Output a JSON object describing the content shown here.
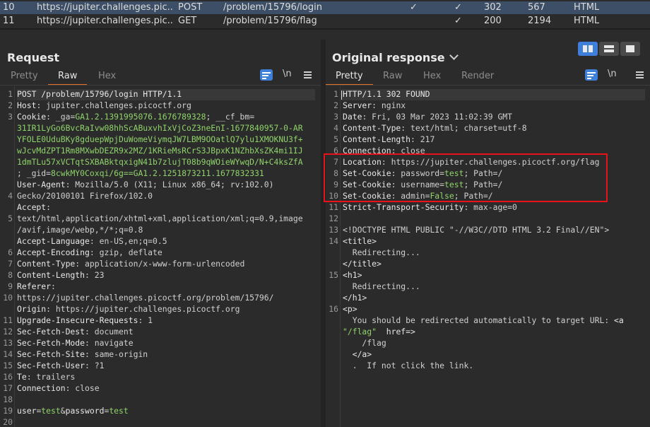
{
  "history": {
    "rows": [
      {
        "num": "10",
        "host": "https://jupiter.challenges.pic...",
        "method": "POST",
        "url": "/problem/15796/login",
        "edited": "✓",
        "params": "✓",
        "status": "302",
        "length": "567",
        "mime": "HTML"
      },
      {
        "num": "11",
        "host": "https://jupiter.challenges.pic...",
        "method": "GET",
        "url": "/problem/15796/flag",
        "edited": "",
        "params": "✓",
        "status": "200",
        "length": "2194",
        "mime": "HTML"
      }
    ]
  },
  "request": {
    "title": "Request",
    "tabs": [
      "Pretty",
      "Raw",
      "Hex"
    ],
    "active_tab": "Raw",
    "newline_label": "\\n",
    "line_numbers": [
      "1",
      "2",
      "3",
      "",
      "",
      "",
      "",
      "",
      "",
      "4",
      "",
      "5",
      "",
      "",
      "6",
      "7",
      "8",
      "9",
      "10",
      "",
      "11",
      "12",
      "13",
      "14",
      "15",
      "16",
      "17",
      "18",
      "19",
      "20"
    ],
    "lines": [
      {
        "k": "POST /problem/15796/login HTTP/1.1",
        "v": ""
      },
      {
        "k": "Host",
        "v": ": jupiter.challenges.picoctf.org"
      },
      {
        "k": "Cookie",
        "v": ": _ga=",
        "g": "GA1.2.1391995076.1676789328",
        "v2": "; __cf_bm="
      },
      {
        "g": "31IR1LyGo6BvcRaIvw08hhScABuxvhIxVjCoZ3neEnI-1677840957-0-AR"
      },
      {
        "g": "YFOLE0UduBKy8gduepWpjDuWomeViymqJW7LBM9OOatlQ7ylu1XMOKNU3f+"
      },
      {
        "g": "wJcvMdZPT1Rm8MXwbDEZR9x2MZ/1KRieMsRCrS3JBpxK1NZhbXsZK4mi1IJ"
      },
      {
        "g": "1dmTLu57xVCTqtSXBABktqxigN41b7zlujT08b9qWOieWYwqD/N+C4ksZfA"
      },
      {
        "g": "8cwkMY0Coxqi/6g==",
        "v": "; _gid=",
        "g2": "GA1.2.1251873211.1677832331"
      },
      {
        "k": "User-Agent",
        "v": ": Mozilla/5.0 (X11; Linux x86_64; rv:102.0)"
      },
      {
        "v": "Gecko/20100101 Firefox/102.0"
      },
      {
        "k": "Accept",
        "v": ":"
      },
      {
        "v": "text/html,application/xhtml+xml,application/xml;q=0.9,image"
      },
      {
        "v": "/avif,image/webp,*/*;q=0.8"
      },
      {
        "k": "Accept-Language",
        "v": ": en-US,en;q=0.5"
      },
      {
        "k": "Accept-Encoding",
        "v": ": gzip, deflate"
      },
      {
        "k": "Content-Type",
        "v": ": application/x-www-form-urlencoded"
      },
      {
        "k": "Content-Length",
        "v": ": 23"
      },
      {
        "k": "Referer",
        "v": ":"
      },
      {
        "v": "https://jupiter.challenges.picoctf.org/problem/15796/"
      },
      {
        "k": "Origin",
        "v": ": https://jupiter.challenges.picoctf.org"
      },
      {
        "k": "Upgrade-Insecure-Requests",
        "v": ": 1"
      },
      {
        "k": "Sec-Fetch-Dest",
        "v": ": document"
      },
      {
        "k": "Sec-Fetch-Mode",
        "v": ": navigate"
      },
      {
        "k": "Sec-Fetch-Site",
        "v": ": same-origin"
      },
      {
        "k": "Sec-Fetch-User",
        "v": ": ?1"
      },
      {
        "k": "Te",
        "v": ": trailers"
      },
      {
        "k": "Connection",
        "v": ": close"
      },
      {
        "v": ""
      },
      {
        "v": "",
        "body": true
      }
    ],
    "body": {
      "p1": "user",
      "e1": "=",
      "v1": "test",
      "amp": "&",
      "p2": "password",
      "e2": "=",
      "v2": "test"
    }
  },
  "response": {
    "title": "Original response",
    "tabs": [
      "Pretty",
      "Raw",
      "Hex",
      "Render"
    ],
    "active_tab": "Pretty",
    "newline_label": "\\n",
    "line_numbers": [
      "1",
      "2",
      "3",
      "4",
      "5",
      "6",
      "7",
      "8",
      "9",
      "10",
      "11",
      "12",
      "13",
      "14",
      "",
      "",
      "15",
      "",
      "",
      "16",
      "",
      "",
      "",
      "",
      ""
    ],
    "lines": [
      {
        "k": "HTTP/1.1 302 FOUND",
        "v": ""
      },
      {
        "k": "Server",
        "v": ": nginx"
      },
      {
        "k": "Date",
        "v": ": Fri, 03 Mar 2023 11:02:39 GMT"
      },
      {
        "k": "Content-Type",
        "v": ": text/html; charset=utf-8"
      },
      {
        "k": "Content-Length",
        "v": ": 217"
      },
      {
        "k": "Connection",
        "v": ": close"
      },
      {
        "k": "Location",
        "v": ": https://jupiter.challenges.picoctf.org/flag"
      },
      {
        "k": "Set-Cookie",
        "v": ": password=",
        "g": "test",
        "v2": "; Path=/"
      },
      {
        "k": "Set-Cookie",
        "v": ": username=",
        "g": "test",
        "v2": "; Path=/"
      },
      {
        "k": "Set-Cookie",
        "v": ": admin=",
        "g": "False",
        "v2": "; Path=/"
      },
      {
        "k": "Strict-Transport-Security",
        "v": ": max-age=0"
      },
      {
        "v": ""
      },
      {
        "v": "<!DOCTYPE HTML PUBLIC \"-//W3C//DTD HTML 3.2 Final//EN\">"
      },
      {
        "t": "<title>"
      },
      {
        "v": "  Redirecting..."
      },
      {
        "t": "</title>"
      },
      {
        "t": "<h1>"
      },
      {
        "v": "  Redirecting..."
      },
      {
        "t": "</h1>"
      },
      {
        "t": "<p>"
      },
      {
        "v": "  You should be redirected automatically to target URL: ",
        "t": "<a"
      },
      {
        "t": "  href=",
        "g": "\"/flag\"",
        "t2": ">"
      },
      {
        "v": "    /flag"
      },
      {
        "t": "  </a>"
      },
      {
        "v": "  .  If not click the link."
      }
    ]
  }
}
